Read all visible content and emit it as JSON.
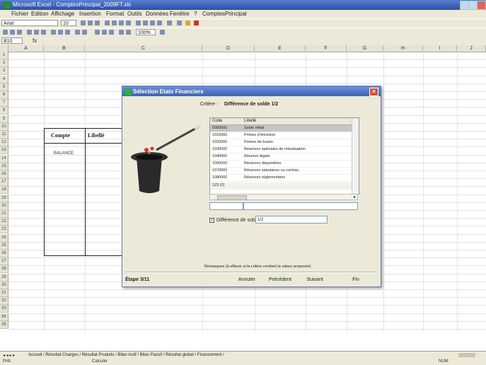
{
  "window": {
    "title": "Microsoft Excel - ComptesPrincipal_2009FT.xls"
  },
  "menu": [
    "Fichier",
    "Edition",
    "Affichage",
    "Insertion",
    "Format",
    "Outils",
    "Données",
    "Fenêtre",
    "?",
    "ComptesPrincipal"
  ],
  "toolbar": {
    "font": "Arial",
    "size": "10",
    "zoom": "100%"
  },
  "formula": {
    "namebox": "B10",
    "fx": "fx"
  },
  "columns": [
    "A",
    "B",
    "C",
    "D",
    "E",
    "F",
    "G",
    "H",
    "I",
    "J"
  ],
  "rows": [
    "1",
    "2",
    "3",
    "4",
    "5",
    "6",
    "7",
    "8",
    "9",
    "10",
    "11",
    "12",
    "13",
    "14",
    "15",
    "16",
    "17",
    "18",
    "19",
    "20",
    "21",
    "22",
    "23",
    "24",
    "25",
    "26",
    "27",
    "28",
    "29",
    "30",
    "31",
    "32",
    "33",
    "34",
    "35"
  ],
  "cells": {
    "compte": "Compte",
    "libelle": "Libellé",
    "value": "BALANCE"
  },
  "dialog": {
    "title": "Sélection Etats Financiers",
    "criteria_label": "Critère :",
    "criteria_value": "Différence de solde 1/2",
    "list": {
      "headers": [
        "Code",
        "Libellé"
      ],
      "rows": [
        [
          "0000000",
          "Solde initial"
        ],
        [
          "1010000",
          "Primes d'émission"
        ],
        [
          "1020000",
          "Primes de fusion"
        ],
        [
          "1030000",
          "Réserves spéciales de réévaluation"
        ],
        [
          "1040000",
          "Réserve légale"
        ],
        [
          "1060000",
          "Réserves disponibles"
        ],
        [
          "1070000",
          "Réserves statutaires ou contrac."
        ],
        [
          "1080000",
          "Réserves réglementées"
        ]
      ],
      "footer": "123 (2)"
    },
    "field_empty": "",
    "checkbox_label": "Différence de solde :",
    "checkbox_value": "1/2",
    "note": "Remarques (à effacer si la critère contient la valeur proposée)",
    "step": "Étape 3/11",
    "buttons": {
      "cancel": "Annuler",
      "back": "Précédent",
      "next": "Suivant",
      "finish": "Fin"
    }
  },
  "sheet_tabs": "Accueil / Résultat Charges / Résultat Produits / Bilan Actif / Bilan Passif / Résultat global / Financement /",
  "status": {
    "left": "Prêt",
    "mid": "Calculer",
    "right": "NUM"
  }
}
